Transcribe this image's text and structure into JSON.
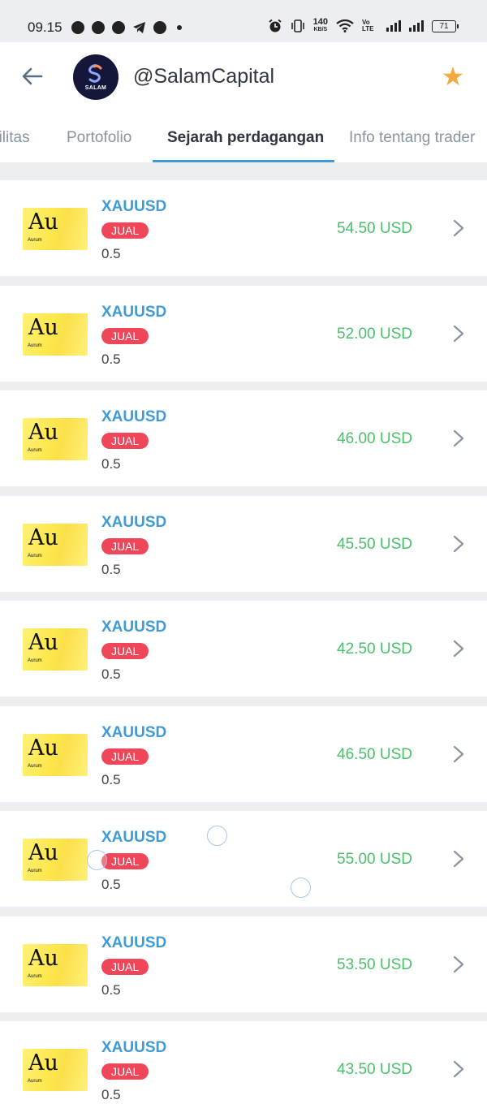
{
  "status_bar": {
    "time": "09.15",
    "net_speed_value": "140",
    "net_speed_unit": "KB/S",
    "volte": "Vo LTE",
    "battery": "71",
    "left_icons": [
      "whatsapp-icon",
      "facebook-icon",
      "b-icon",
      "telegram-icon",
      "facebook-icon"
    ],
    "right_icons": [
      "alarm-icon",
      "vibrate-icon",
      "wifi-icon",
      "signal-icon",
      "signal-icon",
      "battery-icon"
    ]
  },
  "header": {
    "profile_name": "@SalamCapital",
    "avatar_brand": "SALAM",
    "accent_color": "#3f9bd6",
    "star_color": "#f4a83f"
  },
  "tabs": [
    {
      "label": "bilitas"
    },
    {
      "label": "Portofolio"
    },
    {
      "label": "Sejarah perdagangan",
      "active": true
    },
    {
      "label": "Info tentang trader"
    }
  ],
  "asset_icon": {
    "symbol": "Au",
    "name": "Aurum"
  },
  "trades": [
    {
      "symbol": "XAUUSD",
      "side": "JUAL",
      "volume": "0.5",
      "profit": "54.50 USD"
    },
    {
      "symbol": "XAUUSD",
      "side": "JUAL",
      "volume": "0.5",
      "profit": "52.00 USD"
    },
    {
      "symbol": "XAUUSD",
      "side": "JUAL",
      "volume": "0.5",
      "profit": "46.00 USD"
    },
    {
      "symbol": "XAUUSD",
      "side": "JUAL",
      "volume": "0.5",
      "profit": "45.50 USD"
    },
    {
      "symbol": "XAUUSD",
      "side": "JUAL",
      "volume": "0.5",
      "profit": "42.50 USD"
    },
    {
      "symbol": "XAUUSD",
      "side": "JUAL",
      "volume": "0.5",
      "profit": "46.50 USD"
    },
    {
      "symbol": "XAUUSD",
      "side": "JUAL",
      "volume": "0.5",
      "profit": "55.00 USD"
    },
    {
      "symbol": "XAUUSD",
      "side": "JUAL",
      "volume": "0.5",
      "profit": "53.50 USD"
    },
    {
      "symbol": "XAUUSD",
      "side": "JUAL",
      "volume": "0.5",
      "profit": "43.50 USD"
    }
  ],
  "colors": {
    "profit": "#4cbf6b",
    "sell_badge": "#f0465a",
    "symbol": "#3f9bd6"
  }
}
